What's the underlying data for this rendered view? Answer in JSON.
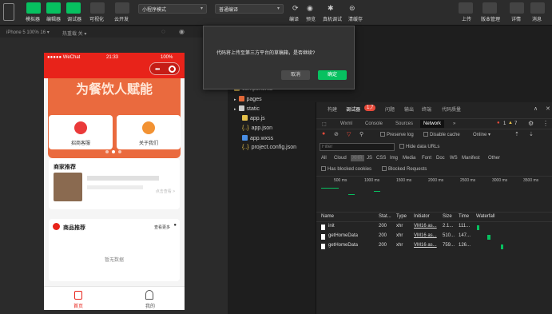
{
  "toolbar": {
    "buttons": [
      {
        "label": "模拟器"
      },
      {
        "label": "编辑器"
      },
      {
        "label": "调试器"
      },
      {
        "label": "可视化"
      },
      {
        "label": "云开发"
      }
    ],
    "mode_select": "小程序模式",
    "compile_select": "普通编译",
    "actions": [
      "编译",
      "预览",
      "真机调试",
      "清缓存"
    ],
    "right_actions": [
      "上传",
      "版本管理",
      "详情",
      "消息"
    ]
  },
  "subbar": {
    "device": "iPhone 5 100% 16 ▾",
    "hotreload": "热重载 关 ▾"
  },
  "phone": {
    "carrier": "●●●●● WeChat",
    "time": "21:33",
    "battery": "100%",
    "banner_text": "为餐饮人赋能",
    "cards": [
      "招商客服",
      "关于我们"
    ],
    "merchant_title": "商家推荐",
    "merchant_more": "点击查看 >",
    "goods_title": "商品推荐",
    "goods_more": "查看更多",
    "goods_empty": "暂无数据",
    "tabs": [
      {
        "label": "首页"
      },
      {
        "label": "我的"
      }
    ]
  },
  "tree": {
    "items": [
      "components",
      "pages",
      "static",
      "app.js",
      "app.json",
      "app.wxss",
      "project.config.json"
    ]
  },
  "devtools": {
    "top_tabs": [
      "构建",
      "调试器",
      "问题",
      "输出",
      "终端",
      "代码质量"
    ],
    "badge": "1,7",
    "panel_tabs": [
      "Wxml",
      "Console",
      "Sources",
      "Network",
      "»"
    ],
    "error_count": "1",
    "warn_count": "7",
    "preserve_log": "Preserve log",
    "disable_cache": "Disable cache",
    "online": "Online",
    "filter_placeholder": "Filter",
    "hide_data_urls": "Hide data URLs",
    "filter_types": [
      "All",
      "Cloud",
      "XHR",
      "JS",
      "CSS",
      "Img",
      "Media",
      "Font",
      "Doc",
      "WS",
      "Manifest",
      "Other"
    ],
    "has_blocked": "Has blocked cookies",
    "blocked_requests": "Blocked Requests",
    "timeline_ticks": [
      "500 ms",
      "1000 ms",
      "1500 ms",
      "2000 ms",
      "2500 ms",
      "3000 ms",
      "3500 ms"
    ],
    "columns": [
      "Name",
      "Stat...",
      "Type",
      "Initiator",
      "Size",
      "Time",
      "Waterfall"
    ],
    "rows": [
      {
        "name": "init",
        "status": "200",
        "type": "xhr",
        "initiator": "VM16 as...",
        "size": "2.1...",
        "time": "111..."
      },
      {
        "name": "getHomeData",
        "status": "200",
        "type": "xhr",
        "initiator": "VM16 as...",
        "size": "510...",
        "time": "147..."
      },
      {
        "name": "getHomeData",
        "status": "200",
        "type": "xhr",
        "initiator": "VM16 as...",
        "size": "759...",
        "time": "126..."
      }
    ]
  },
  "modal": {
    "message": "代码将上传至第三方平台的草稿箱，是否继续?",
    "cancel": "取消",
    "confirm": "确定"
  },
  "colors": {
    "accent_green": "#07c160",
    "wechat_red": "#e8231a",
    "banner_orange": "#ea6a3e",
    "network_tab_bg": "#111111"
  }
}
